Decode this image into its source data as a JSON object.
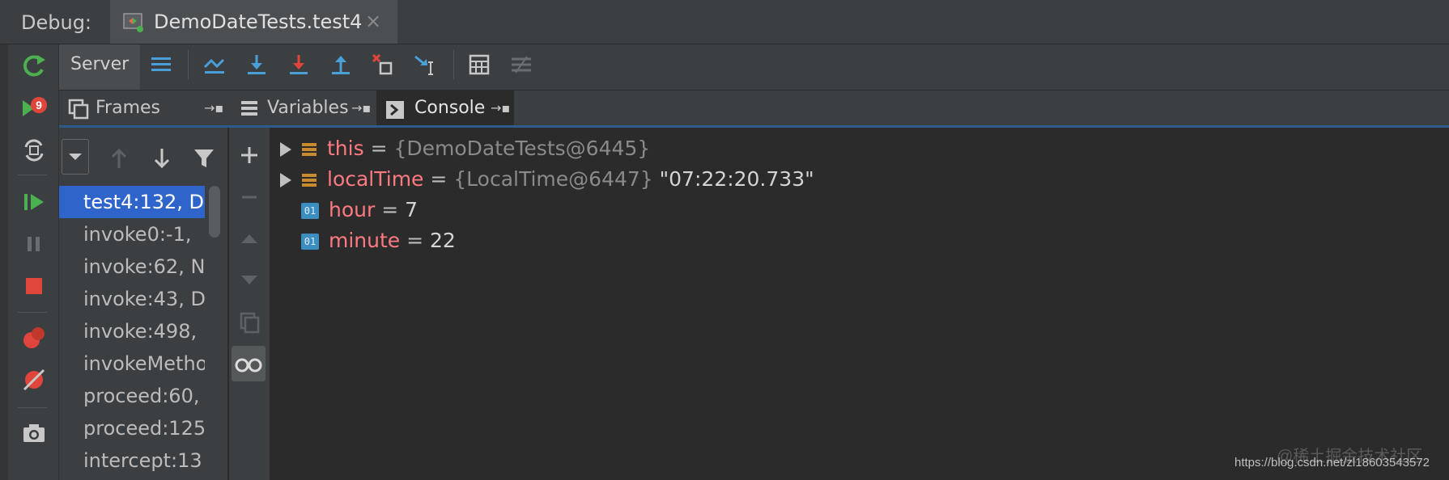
{
  "titlebar": {
    "label": "Debug:",
    "session_title": "DemoDateTests.test4",
    "close": "×"
  },
  "toolbar": {
    "server_tab": "Server"
  },
  "tabs": {
    "frames": "Frames",
    "variables": "Variables",
    "console": "Console",
    "pin": "→▪"
  },
  "frames": [
    {
      "label": "test4:132, D",
      "selected": true
    },
    {
      "label": "invoke0:-1,"
    },
    {
      "label": "invoke:62, N"
    },
    {
      "label": "invoke:43, D"
    },
    {
      "label": "invoke:498,"
    },
    {
      "label": "invokeMetho"
    },
    {
      "label": "proceed:60,"
    },
    {
      "label": "proceed:125"
    },
    {
      "label": "intercept:13"
    }
  ],
  "variables": [
    {
      "name": "this",
      "eq": " = ",
      "type": "{DemoDateTests@6445}",
      "value": "",
      "expandable": true,
      "kind": "object"
    },
    {
      "name": "localTime",
      "eq": " = ",
      "type": "{LocalTime@6447}",
      "value": " \"07:22:20.733\"",
      "expandable": true,
      "kind": "object"
    },
    {
      "name": "hour",
      "eq": " = ",
      "type": "",
      "value": "7",
      "expandable": false,
      "kind": "primitive"
    },
    {
      "name": "minute",
      "eq": " = ",
      "type": "",
      "value": "22",
      "expandable": false,
      "kind": "primitive"
    }
  ],
  "primitive_badge": "01",
  "watermark": {
    "line1": "@稀土掘金技术社区",
    "line2": "https://blog.csdn.net/zl18603543572"
  },
  "colors": {
    "accent": "#2f65ca",
    "var_name": "#ff7a80",
    "resume": "#4caf50",
    "stop": "#e0453b"
  }
}
